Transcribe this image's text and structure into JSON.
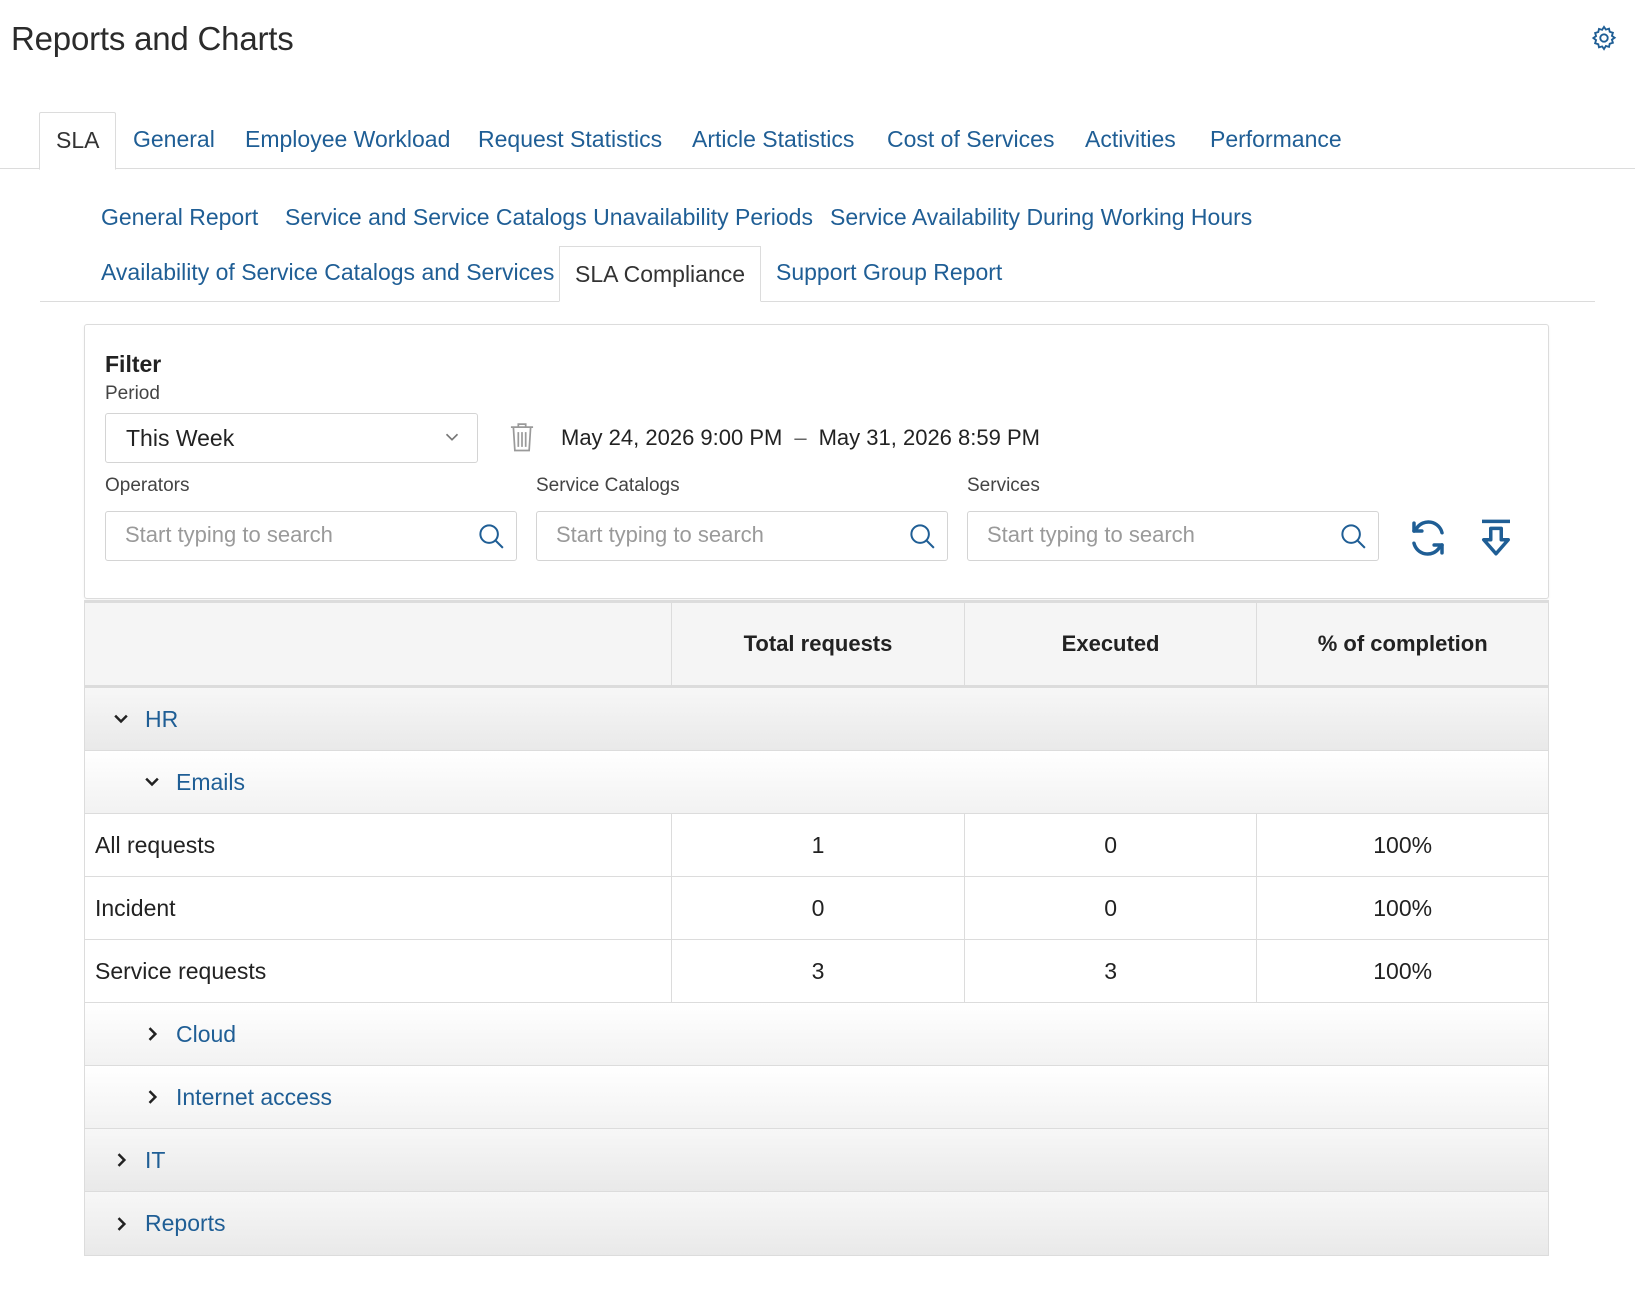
{
  "page": {
    "title": "Reports and Charts"
  },
  "top_tabs": [
    {
      "label": "SLA",
      "active": true
    },
    {
      "label": "General"
    },
    {
      "label": "Employee Workload"
    },
    {
      "label": "Request Statistics"
    },
    {
      "label": "Article Statistics"
    },
    {
      "label": "Cost of Services"
    },
    {
      "label": "Activities"
    },
    {
      "label": "Performance"
    }
  ],
  "sub_tabs": [
    {
      "label": "General Report"
    },
    {
      "label": "Service and Service Catalogs Unavailability Periods"
    },
    {
      "label": "Service Availability During Working Hours"
    },
    {
      "label": "Availability of Service Catalogs and Services"
    },
    {
      "label": "SLA Compliance",
      "active": true
    },
    {
      "label": "Support Group Report"
    }
  ],
  "filter": {
    "title": "Filter",
    "period_label": "Period",
    "period_value": "This Week",
    "date_from": "May 24, 2026 9:00 PM",
    "date_separator": "–",
    "date_to": "May 31, 2026 8:59 PM",
    "operators_label": "Operators",
    "operators_placeholder": "Start typing to search",
    "catalogs_label": "Service Catalogs",
    "catalogs_placeholder": "Start typing to search",
    "services_label": "Services",
    "services_placeholder": "Start typing to search"
  },
  "table": {
    "columns": [
      "",
      "Total requests",
      "Executed",
      "% of completion"
    ],
    "groups": {
      "hr": "HR",
      "emails": "Emails",
      "cloud": "Cloud",
      "internet": "Internet access",
      "it": "IT",
      "reports": "Reports"
    },
    "rows": [
      {
        "name": "All requests",
        "total": "1",
        "executed": "0",
        "completion": "100%"
      },
      {
        "name": "Incident",
        "total": "0",
        "executed": "0",
        "completion": "100%"
      },
      {
        "name": "Service requests",
        "total": "3",
        "executed": "3",
        "completion": "100%"
      }
    ]
  },
  "colors": {
    "link": "#1f5e95",
    "border": "#dcdcdc"
  },
  "icons": [
    "gear-icon",
    "chevron-down-icon",
    "trash-icon",
    "search-icon",
    "refresh-icon",
    "export-icon",
    "chevron-right-icon"
  ]
}
